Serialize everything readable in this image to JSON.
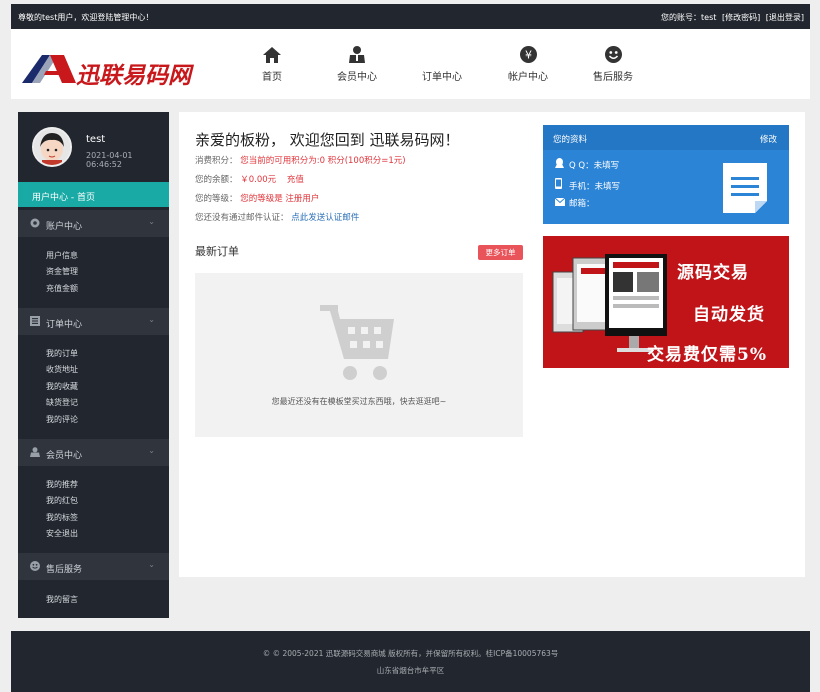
{
  "topbar": {
    "welcome": "尊敬的test用户，欢迎登陆管理中心！",
    "account_label": "您的账号：test",
    "change_password": "[修改密码]",
    "logout": "[退出登录]"
  },
  "brand": {
    "logo_text": "迅联易码网"
  },
  "nav": [
    {
      "label": "首页",
      "icon": "home-icon"
    },
    {
      "label": "会员中心",
      "icon": "member-icon"
    },
    {
      "label": "订单中心",
      "icon": "order-icon"
    },
    {
      "label": "帐户中心",
      "icon": "yen-icon"
    },
    {
      "label": "售后服务",
      "icon": "smile-icon"
    }
  ],
  "sidebar": {
    "username": "test",
    "time": "2021-04-01 06:46:52",
    "current": "用户中心 - 首页",
    "sections": [
      {
        "title": "账户中心",
        "icon": "gear-icon",
        "items": [
          "用户信息",
          "资金管理",
          "充值金额"
        ]
      },
      {
        "title": "订单中心",
        "icon": "list-icon",
        "items": [
          "我的订单",
          "收货地址",
          "我的收藏",
          "缺货登记",
          "我的评论"
        ]
      },
      {
        "title": "会员中心",
        "icon": "user-icon",
        "items": [
          "我的推荐",
          "我的红包",
          "我的标签",
          "安全退出"
        ]
      },
      {
        "title": "售后服务",
        "icon": "smile-icon",
        "items": [
          "我的留言"
        ]
      }
    ]
  },
  "main": {
    "greeting": "亲爱的板粉， 欢迎您回到 迅联易码网！",
    "points_label": "消费积分：",
    "points_value": "您当前的可用积分为:0 积分(100积分=1元)",
    "balance_label": "您的余额：",
    "balance_value": "￥0.00元",
    "recharge": "充值",
    "level_label": "您的等级：",
    "level_value": "您的等级是 注册用户",
    "email_label": "您还没有通过邮件认证：",
    "email_link": "点此发送认证邮件",
    "orders_title": "最新订单",
    "more_orders": "更多订单",
    "empty_text": "您最近还没有在模板堂买过东西哦，快去逛逛吧~"
  },
  "profile_card": {
    "title": "您的资料",
    "edit": "修改",
    "qq_label": "Q Q：",
    "qq_value": "未填写",
    "phone_label": "手机：",
    "phone_value": "未填写",
    "email_label": "邮箱：",
    "email_value": ""
  },
  "banner": {
    "line1": "源码交易",
    "line2": "自动发货",
    "line3": "交易费仅需5%"
  },
  "footer": {
    "copyright": "© © 2005-2021 迅联源码交易商城 版权所有，并保留所有权利。桂ICP备10005763号",
    "address": "山东省烟台市牟平区"
  }
}
